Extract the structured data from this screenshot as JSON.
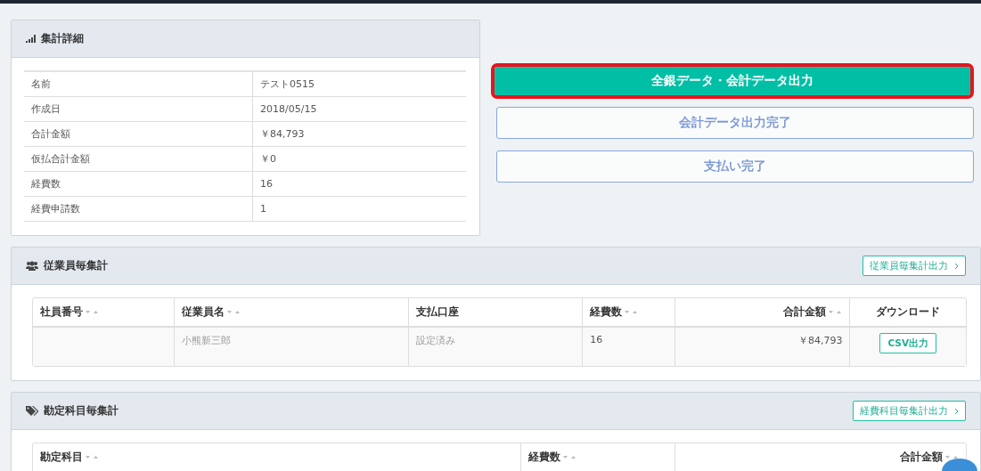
{
  "summary": {
    "title": "集計詳細",
    "rows": [
      {
        "label": "名前",
        "value": "テスト0515"
      },
      {
        "label": "作成日",
        "value": "2018/05/15"
      },
      {
        "label": "合計金額",
        "value": "￥84,793"
      },
      {
        "label": "仮払合計金額",
        "value": "￥0"
      },
      {
        "label": "経費数",
        "value": "16"
      },
      {
        "label": "経費申請数",
        "value": "1"
      }
    ]
  },
  "actions": [
    {
      "label": "全銀データ・会計データ出力",
      "kind": "primary",
      "highlighted": true
    },
    {
      "label": "会計データ出力完了",
      "kind": "outline",
      "highlighted": false
    },
    {
      "label": "支払い完了",
      "kind": "outline",
      "highlighted": false
    }
  ],
  "employee_totals": {
    "title": "従業員毎集計",
    "export_button": "従業員毎集計出力",
    "columns": [
      {
        "label": "社員番号",
        "sortable": true,
        "kind": "text"
      },
      {
        "label": "従業員名",
        "sortable": true,
        "kind": "text"
      },
      {
        "label": "支払口座",
        "sortable": false,
        "kind": "text"
      },
      {
        "label": "経費数",
        "sortable": true,
        "kind": "text"
      },
      {
        "label": "合計金額",
        "sortable": true,
        "kind": "amount"
      },
      {
        "label": "ダウンロード",
        "sortable": false,
        "kind": "action"
      }
    ],
    "rows": [
      {
        "name": "小熊新三郎",
        "account": "設定済み",
        "count": "16",
        "total": "￥84,793",
        "download": "CSV出力"
      }
    ]
  },
  "account_totals": {
    "title": "勘定科目毎集計",
    "export_button": "経費科目毎集計出力",
    "columns": [
      {
        "label": "勘定科目",
        "sortable": true,
        "kind": "text"
      },
      {
        "label": "経費数",
        "sortable": true,
        "kind": "text"
      },
      {
        "label": "合計金額",
        "sortable": true,
        "kind": "amount"
      }
    ]
  }
}
